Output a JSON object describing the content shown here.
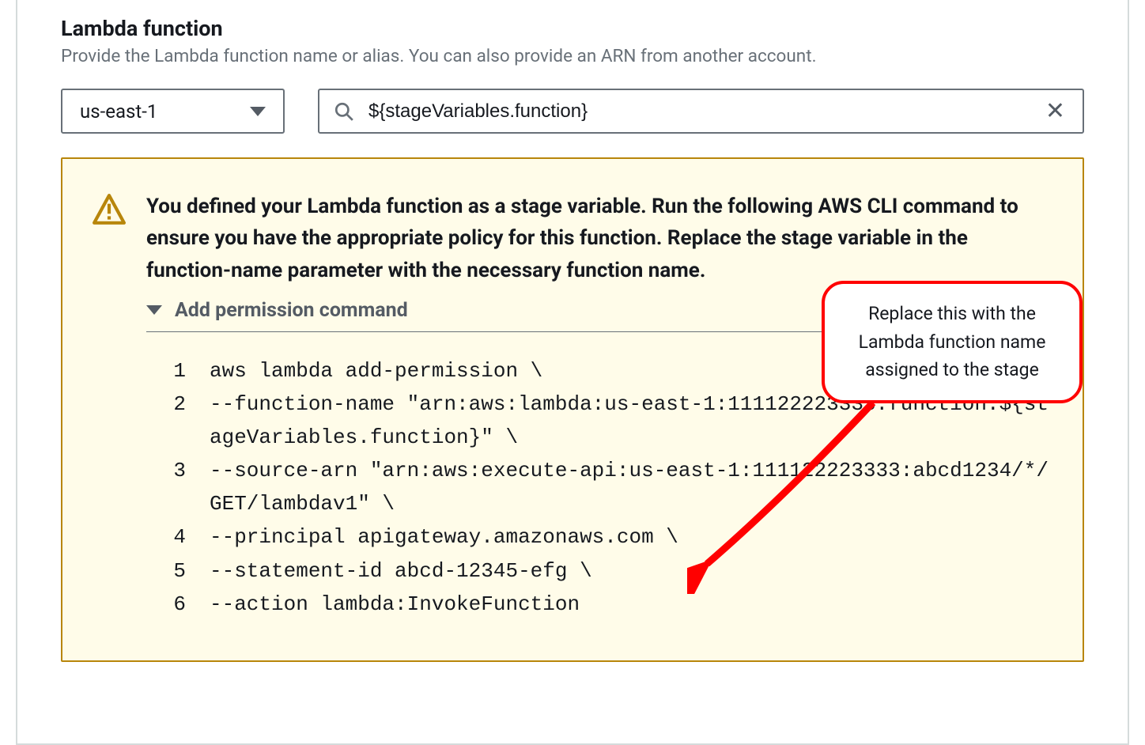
{
  "header": {
    "title": "Lambda function",
    "description": "Provide the Lambda function name or alias. You can also provide an ARN from another account."
  },
  "region_select": {
    "value": "us-east-1"
  },
  "search": {
    "value": "${stageVariables.function}"
  },
  "alert": {
    "heading": "You defined your Lambda function as a stage variable. Run the following AWS CLI command to ensure you have the appropriate policy for this function. Replace the stage variable in the function-name parameter with the necessary function name.",
    "expand_label": "Add permission command",
    "code": [
      "aws lambda add-permission \\",
      "--function-name \"arn:aws:lambda:us-east-1:111122223333:function:${stageVariables.function}\" \\",
      "--source-arn \"arn:aws:execute-api:us-east-1:111122223333:abcd1234/*/GET/lambdav1\" \\",
      "--principal apigateway.amazonaws.com \\",
      "--statement-id abcd-12345-efg \\",
      "--action lambda:InvokeFunction"
    ]
  },
  "callout": {
    "text": "Replace this with the Lambda function name assigned to the stage"
  }
}
